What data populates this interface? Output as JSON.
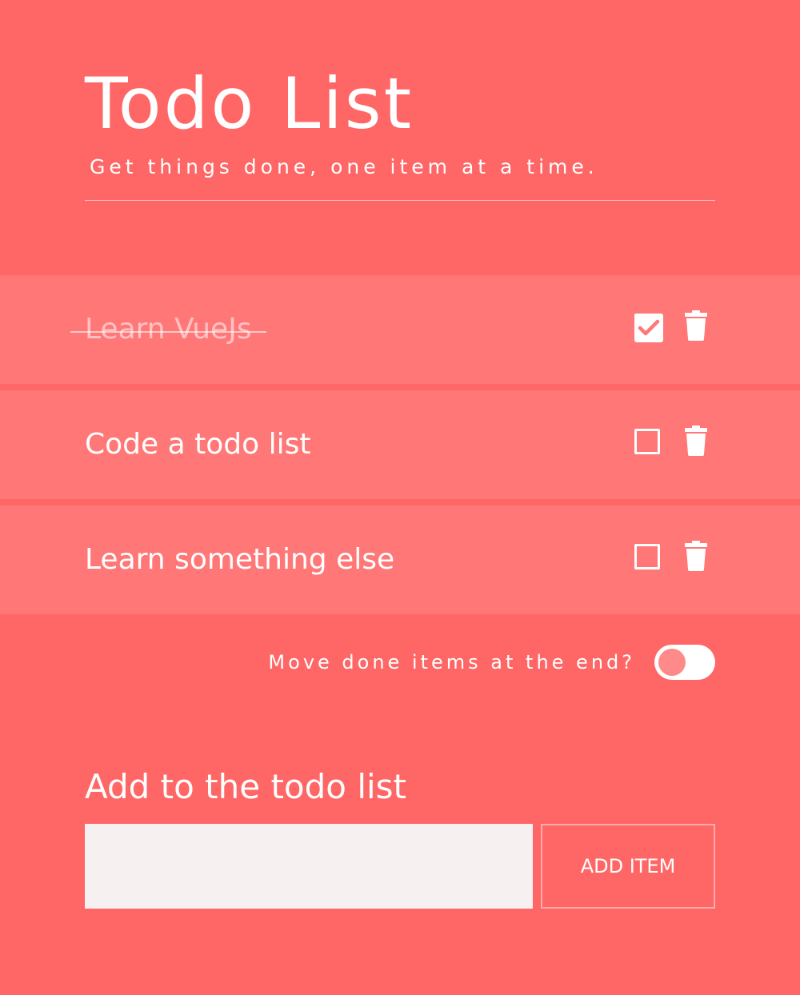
{
  "header": {
    "title": "Todo List",
    "subtitle": "Get things done, one item at a time."
  },
  "todos": [
    {
      "text": "Learn VueJs",
      "done": true
    },
    {
      "text": "Code a todo list",
      "done": false
    },
    {
      "text": "Learn something else",
      "done": false
    }
  ],
  "toggle": {
    "label": "Move done items at the end?",
    "on": false
  },
  "add": {
    "heading": "Add to the todo list",
    "input_value": "",
    "button_label": "ADD ITEM"
  },
  "colors": {
    "background": "#ff6666",
    "item_background": "#ff7777",
    "input_background": "#f6f0f0",
    "text": "#ffffff"
  },
  "icons": {
    "checkbox_checked": "check-square-icon",
    "checkbox_unchecked": "square-icon",
    "delete": "trash-icon"
  }
}
